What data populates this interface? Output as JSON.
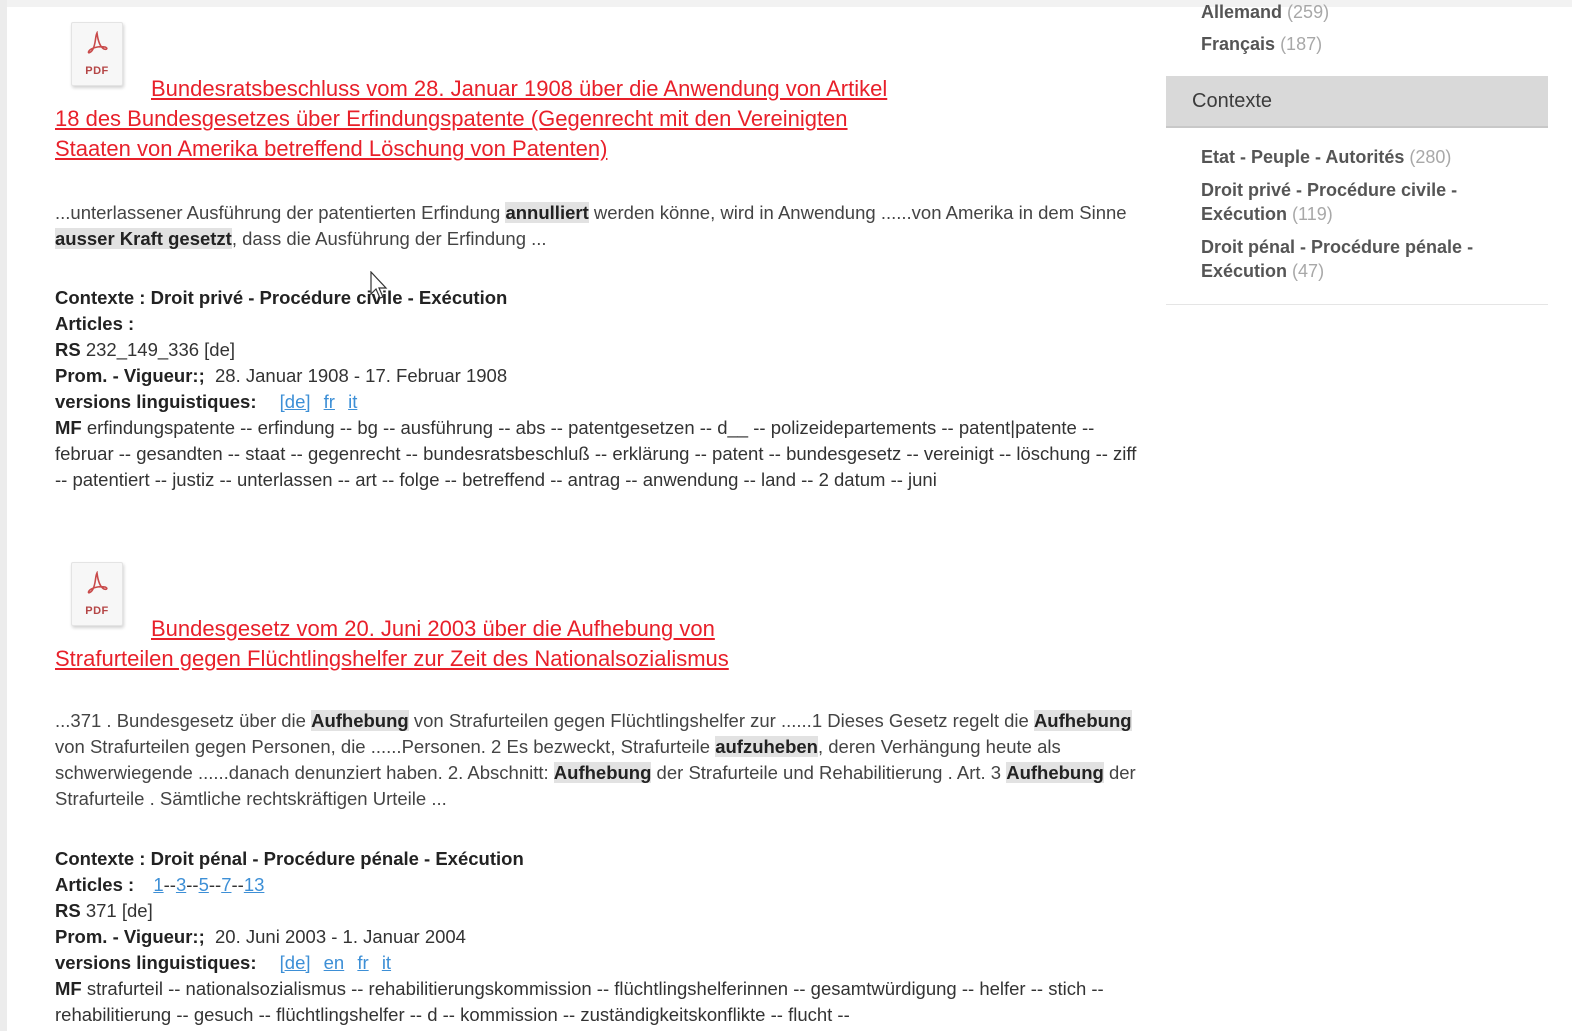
{
  "sidebar": {
    "languages": [
      {
        "label": "Allemand",
        "count": "(259)"
      },
      {
        "label": "Français",
        "count": "(187)"
      }
    ],
    "contexte_header": "Contexte",
    "contexte_items": [
      {
        "line1": "Etat - Peuple - Autorités",
        "line2": "",
        "count": "(280)"
      },
      {
        "line1": "Droit privé - Procédure civile -",
        "line2": "Exécution",
        "count": "(119)"
      },
      {
        "line1": "Droit pénal - Procédure pénale -",
        "line2": "Exécution",
        "count": "(47)"
      }
    ]
  },
  "results": [
    {
      "icon_label": "PDF",
      "title": "Bundesratsbeschluss vom 28. Januar 1908 über die Anwendung von Artikel 18 des Bundesgesetzes über Erfindungspatente (Gegenrecht mit den Vereinigten Staaten von Amerika betreffend Löschung von Patenten)",
      "snippet": [
        {
          "t": "...unterlassener Ausführung der patentierten Erfindung ",
          "b": false
        },
        {
          "t": "annulliert",
          "b": true
        },
        {
          "t": " werden könne, wird in Anwendung ......von Amerika in dem Sinne ",
          "b": false
        },
        {
          "t": "ausser Kraft gesetzt",
          "b": true
        },
        {
          "t": ", dass die Ausführung der Erfindung ...",
          "b": false
        }
      ],
      "contexte_label": "Contexte :",
      "contexte_value": "Droit privé - Procédure civile - Exécution",
      "articles_label": "Articles :",
      "articles": [],
      "rs_label": "RS",
      "rs_value": "232_149_336 [de]",
      "prom_label": "Prom. - Vigueur:;",
      "prom_value": "28. Januar 1908 - 17. Februar 1908",
      "versions_label": "versions linguistiques:",
      "versions": [
        "[de]",
        "fr",
        "it"
      ],
      "mf_label": "MF",
      "mf_value": "erfindungspatente -- erfindung -- bg -- ausführung -- abs -- patentgesetzen -- d__ -- polizeidepartements -- patent|patente -- februar -- gesandten -- staat -- gegenrecht -- bundesratsbeschluß -- erklärung -- patent -- bundesgesetz -- vereinigt -- löschung -- ziff -- patentiert -- justiz -- unterlassen -- art -- folge -- betreffend -- antrag -- anwendung -- land -- 2 datum -- juni"
    },
    {
      "icon_label": "PDF",
      "title": "Bundesgesetz vom 20. Juni 2003 über die Aufhebung von Strafurteilen gegen Flüchtlingshelfer zur Zeit des Nationalsozialismus",
      "snippet": [
        {
          "t": "...371 . Bundesgesetz über die ",
          "b": false
        },
        {
          "t": "Aufhebung",
          "b": true
        },
        {
          "t": " von Strafurteilen gegen Flüchtlingshelfer zur ......1 Dieses Gesetz regelt die ",
          "b": false
        },
        {
          "t": "Aufhebung",
          "b": true
        },
        {
          "t": " von Strafurteilen gegen Personen, die ......Personen. 2 Es bezweckt, Strafurteile ",
          "b": false
        },
        {
          "t": "aufzuheben",
          "b": true
        },
        {
          "t": ", deren Verhängung heute als schwerwiegende ......danach denunziert haben. 2. Abschnitt: ",
          "b": false
        },
        {
          "t": "Aufhebung",
          "b": true
        },
        {
          "t": " der Strafurteile und Rehabilitierung . Art. 3 ",
          "b": false
        },
        {
          "t": "Aufhebung",
          "b": true
        },
        {
          "t": " der Strafurteile . Sämtliche rechtskräftigen Urteile ...",
          "b": false
        }
      ],
      "contexte_label": "Contexte :",
      "contexte_value": "Droit pénal - Procédure pénale - Exécution",
      "articles_label": "Articles :",
      "articles": [
        "1",
        "3",
        "5",
        "7",
        "13"
      ],
      "rs_label": "RS",
      "rs_value": "371 [de]",
      "prom_label": "Prom. - Vigueur:;",
      "prom_value": "20. Juni 2003 - 1. Januar 2004",
      "versions_label": "versions linguistiques:",
      "versions": [
        "[de]",
        "en",
        "fr",
        "it"
      ],
      "mf_label": "MF",
      "mf_value": "strafurteil -- nationalsozialismus -- rehabilitierungskommission -- flüchtlingshelferinnen -- gesamtwürdigung -- helfer -- stich -- rehabilitierung -- gesuch -- flüchtlingshelfer -- d -- kommission -- zuständigkeitskonflikte -- flucht --"
    }
  ],
  "colors": {
    "title_link": "#e8202a",
    "lang_link": "#3d8fd6",
    "highlight_bg": "#e2e2e2",
    "sidebar_header_bg": "#d9d9d9"
  }
}
